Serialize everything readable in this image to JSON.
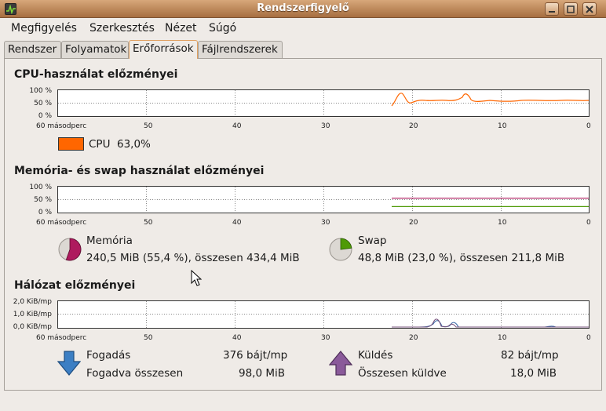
{
  "window": {
    "title": "Rendszerfigyelő"
  },
  "menu": [
    {
      "label": "Megfigyelés"
    },
    {
      "label": "Szerkesztés"
    },
    {
      "label": "Nézet"
    },
    {
      "label": "Súgó"
    }
  ],
  "tabs": [
    {
      "label": "Rendszer"
    },
    {
      "label": "Folyamatok"
    },
    {
      "label": "Erőforrások"
    },
    {
      "label": "Fájlrendszerek"
    }
  ],
  "active_tab": "Erőforrások",
  "cpu": {
    "title": "CPU-használat előzményei",
    "y_labels": [
      "100 %",
      "50 %",
      "0 %"
    ],
    "x_labels": [
      "60 másodperc",
      "50",
      "40",
      "30",
      "20",
      "10",
      "0"
    ],
    "label": "CPU",
    "value": "63,0%",
    "color": "#ff6600"
  },
  "memory": {
    "title": "Memória- és swap használat előzményei",
    "y_labels": [
      "100 %",
      "50 %",
      "0 %"
    ],
    "x_labels": [
      "60 másodperc",
      "50",
      "40",
      "30",
      "20",
      "10",
      "0"
    ],
    "mem_label": "Memória",
    "mem_value": "240,5 MiB (55,4 %), összesen 434,4 MiB",
    "mem_fraction": 0.554,
    "mem_color": "#ae1a5e",
    "swap_label": "Swap",
    "swap_value": "48,8 MiB (23,0 %), összesen 211,8 MiB",
    "swap_fraction": 0.23,
    "swap_color": "#4e9a06"
  },
  "network": {
    "title": "Hálózat előzményei",
    "y_labels": [
      "2,0 KiB/mp",
      "1,0 KiB/mp",
      "0,0 KiB/mp"
    ],
    "x_labels": [
      "60 másodperc",
      "50",
      "40",
      "30",
      "20",
      "10",
      "0"
    ],
    "recv_label": "Fogadás",
    "recv_rate": "376 bájt/mp",
    "recv_total_label": "Fogadva összesen",
    "recv_total": "98,0 MiB",
    "send_label": "Küldés",
    "send_rate": "82 bájt/mp",
    "send_total_label": "Összesen küldve",
    "send_total": "18,0 MiB",
    "recv_color": "#3465a4",
    "send_color": "#75507b"
  }
}
